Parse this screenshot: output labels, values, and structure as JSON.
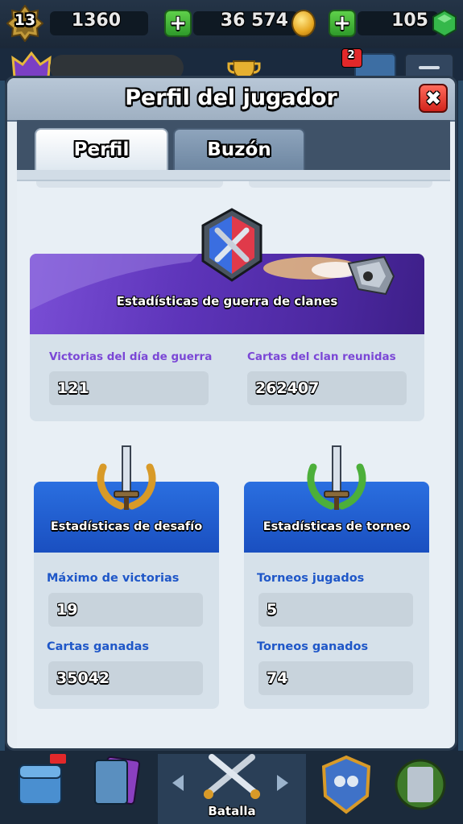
{
  "topbar": {
    "level": "13",
    "experience": "1360",
    "gold": "36 574",
    "gems": "105",
    "icons": {
      "level": "level-star-icon",
      "gold": "coin-icon",
      "gems": "gem-icon",
      "add": "plus-icon"
    }
  },
  "header_row": {
    "notification_count": "2"
  },
  "modal": {
    "title": "Perfil del jugador",
    "close_label": "✖",
    "tabs": [
      {
        "label": "Perfil",
        "active": true
      },
      {
        "label": "Buzón",
        "active": false
      }
    ]
  },
  "clan_war": {
    "title": "Estadísticas de guerra de clanes",
    "stats": [
      {
        "label": "Victorias del día de guerra",
        "value": "121"
      },
      {
        "label": "Cartas del clan reunidas",
        "value": "262407"
      }
    ]
  },
  "challenge": {
    "title": "Estadísticas de desafío",
    "stats": [
      {
        "label": "Máximo de victorias",
        "value": "19"
      },
      {
        "label": "Cartas ganadas",
        "value": "35042"
      }
    ]
  },
  "tournament": {
    "title": "Estadísticas de torneo",
    "stats": [
      {
        "label": "Torneos jugados",
        "value": "5"
      },
      {
        "label": "Torneos ganados",
        "value": "74"
      }
    ]
  },
  "bottom_nav": {
    "center_label": "Batalla"
  },
  "colors": {
    "purple_label": "#7b47d6",
    "blue_label": "#1f57c8",
    "war_banner": "#5d34b9",
    "card_banner": "#1f5ad0",
    "close_red": "#d2231b",
    "plus_green": "#2e9a2a"
  }
}
